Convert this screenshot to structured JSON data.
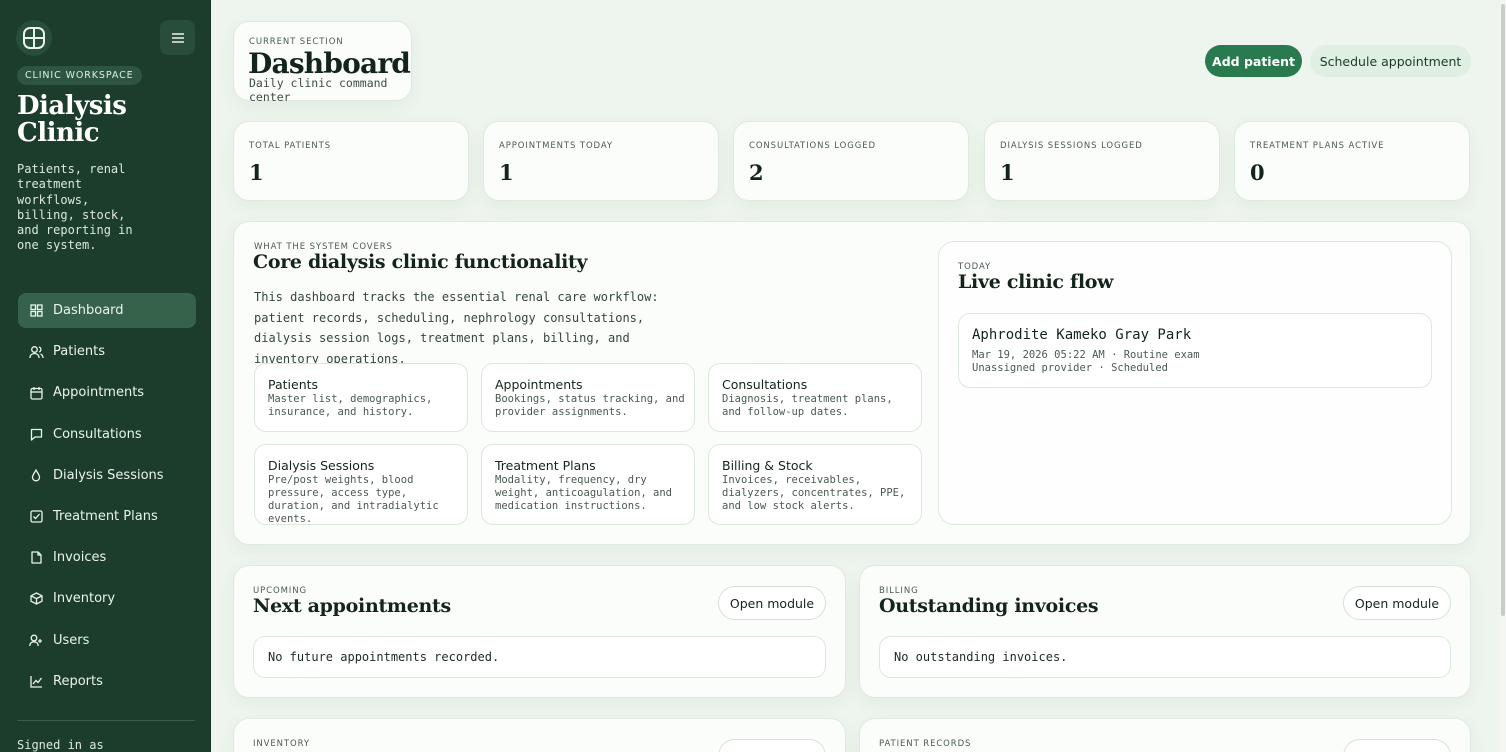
{
  "sidebar": {
    "workspace_badge": "CLINIC WORKSPACE",
    "brand_title": "Dialysis Clinic",
    "brand_desc": "Patients, renal treatment workflows, billing, stock, and reporting in one system.",
    "nav": [
      {
        "label": "Dashboard",
        "icon": "dashboard-icon",
        "active": true
      },
      {
        "label": "Patients",
        "icon": "users-icon"
      },
      {
        "label": "Appointments",
        "icon": "calendar-icon"
      },
      {
        "label": "Consultations",
        "icon": "chat-icon"
      },
      {
        "label": "Dialysis Sessions",
        "icon": "droplet-icon"
      },
      {
        "label": "Treatment Plans",
        "icon": "checklist-icon"
      },
      {
        "label": "Invoices",
        "icon": "document-icon"
      },
      {
        "label": "Inventory",
        "icon": "box-icon"
      },
      {
        "label": "Users",
        "icon": "user-plus-icon"
      },
      {
        "label": "Reports",
        "icon": "chart-icon"
      }
    ],
    "signed_in": "Signed in as"
  },
  "header": {
    "eyebrow": "CURRENT SECTION",
    "title": "Dashboard",
    "subtitle": "Daily clinic command center",
    "add_patient": "Add patient",
    "schedule": "Schedule appointment"
  },
  "stats": [
    {
      "label": "TOTAL PATIENTS",
      "value": "1"
    },
    {
      "label": "APPOINTMENTS TODAY",
      "value": "1"
    },
    {
      "label": "CONSULTATIONS LOGGED",
      "value": "2"
    },
    {
      "label": "DIALYSIS SESSIONS LOGGED",
      "value": "1"
    },
    {
      "label": "TREATMENT PLANS ACTIVE",
      "value": "0"
    }
  ],
  "core": {
    "eyebrow": "WHAT THE SYSTEM COVERS",
    "title": "Core dialysis clinic functionality",
    "description": "This dashboard tracks the essential renal care workflow: patient records, scheduling, nephrology consultations, dialysis session logs, treatment plans, billing, and inventory operations.",
    "tiles": [
      {
        "title": "Patients",
        "desc": "Master list, demographics, insurance, and history."
      },
      {
        "title": "Appointments",
        "desc": "Bookings, status tracking, and provider assignments."
      },
      {
        "title": "Consultations",
        "desc": "Diagnosis, treatment plans, and follow-up dates."
      },
      {
        "title": "Dialysis Sessions",
        "desc": "Pre/post weights, blood pressure, access type, duration, and intradialytic events."
      },
      {
        "title": "Treatment Plans",
        "desc": "Modality, frequency, dry weight, anticoagulation, and medication instructions."
      },
      {
        "title": "Billing & Stock",
        "desc": "Invoices, receivables, dialyzers, concentrates, PPE, and low stock alerts."
      }
    ]
  },
  "flow": {
    "eyebrow": "TODAY",
    "title": "Live clinic flow",
    "item": {
      "name": "Aphrodite Kameko Gray Park",
      "line1": "Mar 19, 2026 05:22 AM · Routine exam",
      "line2": "Unassigned provider · Scheduled"
    }
  },
  "appointments": {
    "eyebrow": "UPCOMING",
    "title": "Next appointments",
    "button": "Open module",
    "empty": "No future appointments recorded."
  },
  "invoices": {
    "eyebrow": "BILLING",
    "title": "Outstanding invoices",
    "button": "Open module",
    "empty": "No outstanding invoices."
  },
  "inventory": {
    "eyebrow": "INVENTORY"
  },
  "records": {
    "eyebrow": "PATIENT RECORDS"
  }
}
